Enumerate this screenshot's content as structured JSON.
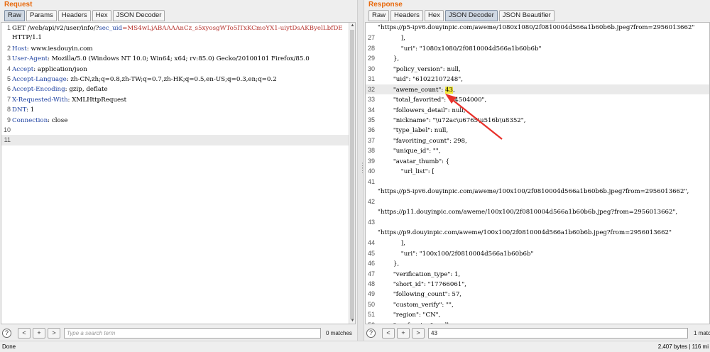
{
  "request": {
    "title": "Request",
    "tabs": [
      "Raw",
      "Params",
      "Headers",
      "Hex",
      "JSON Decoder"
    ],
    "active_tab": "Raw",
    "lines": [
      {
        "n": "1",
        "segments": [
          {
            "t": "GET /web/api/v2/user/info/?",
            "c": ""
          },
          {
            "t": "sec_uid",
            "c": "hname"
          },
          {
            "t": "=MS4wLjABAAAAnCz_s5xyosgWTo5lTxKCmoYX1-uiytDsAKByelLbfDE",
            "c": "hsec"
          }
        ]
      },
      {
        "n": "",
        "segments": [
          {
            "t": "HTTP/1.1",
            "c": ""
          }
        ]
      },
      {
        "n": "2",
        "segments": [
          {
            "t": "Host",
            "c": "hname"
          },
          {
            "t": ": www.iesdouyin.com",
            "c": ""
          }
        ]
      },
      {
        "n": "3",
        "segments": [
          {
            "t": "User-Agent",
            "c": "hname"
          },
          {
            "t": ": Mozilla/5.0 (Windows NT 10.0; Win64; x64; rv:85.0) Gecko/20100101 Firefox/85.0",
            "c": ""
          }
        ]
      },
      {
        "n": "4",
        "segments": [
          {
            "t": "Accept",
            "c": "hname"
          },
          {
            "t": ": application/json",
            "c": ""
          }
        ]
      },
      {
        "n": "5",
        "segments": [
          {
            "t": "Accept-Language",
            "c": "hname"
          },
          {
            "t": ": zh-CN,zh;q=0.8,zh-TW;q=0.7,zh-HK;q=0.5,en-US;q=0.3,en;q=0.2",
            "c": ""
          }
        ]
      },
      {
        "n": "6",
        "segments": [
          {
            "t": "Accept-Encoding",
            "c": "hname"
          },
          {
            "t": ": gzip, deflate",
            "c": ""
          }
        ]
      },
      {
        "n": "7",
        "segments": [
          {
            "t": "X-Requested-With",
            "c": "hname"
          },
          {
            "t": ": XMLHttpRequest",
            "c": ""
          }
        ]
      },
      {
        "n": "8",
        "segments": [
          {
            "t": "DNT",
            "c": "hname"
          },
          {
            "t": ": 1",
            "c": ""
          }
        ]
      },
      {
        "n": "9",
        "segments": [
          {
            "t": "Connection",
            "c": "hname"
          },
          {
            "t": ": close",
            "c": ""
          }
        ]
      },
      {
        "n": "10",
        "segments": []
      },
      {
        "n": "11",
        "segments": [],
        "highlight": true
      }
    ],
    "search": {
      "placeholder": "Type a search term",
      "value": "",
      "matches": "0 matches"
    }
  },
  "response": {
    "title": "Response",
    "tabs": [
      "Raw",
      "Headers",
      "Hex",
      "JSON Decoder",
      "JSON Beautifier"
    ],
    "active_tab": "JSON Decoder",
    "lines": [
      {
        "n": "",
        "t": "\"https://p5-ipv6.douyinpic.com/aweme/1080x1080/2f0810004d566a1b60b6b.jpeg?from=2956013662\""
      },
      {
        "n": "27",
        "t": "            ],"
      },
      {
        "n": "28",
        "t": "            \"uri\": \"1080x1080/2f0810004d566a1b60b6b\""
      },
      {
        "n": "29",
        "t": "        },"
      },
      {
        "n": "30",
        "t": "        \"policy_version\": null,"
      },
      {
        "n": "31",
        "t": "        \"uid\": \"61022107248\","
      },
      {
        "n": "32",
        "t": "        \"aweme_count\": ",
        "mark": "43",
        "after": ",",
        "highlight": true
      },
      {
        "n": "33",
        "t": "        \"total_favorited\": \"44504000\","
      },
      {
        "n": "34",
        "t": "        \"followers_detail\": null,"
      },
      {
        "n": "35",
        "t": "        \"nickname\": \"\\u72ac\\u6765\\u516b\\u8352\","
      },
      {
        "n": "36",
        "t": "        \"type_label\": null,"
      },
      {
        "n": "37",
        "t": "        \"favoriting_count\": 298,"
      },
      {
        "n": "38",
        "t": "        \"unique_id\": \"\","
      },
      {
        "n": "39",
        "t": "        \"avatar_thumb\": {"
      },
      {
        "n": "40",
        "t": "            \"url_list\": ["
      },
      {
        "n": "41",
        "t": ""
      },
      {
        "n": "",
        "t": "\"https://p5-ipv6.douyinpic.com/aweme/100x100/2f0810004d566a1b60b6b.jpeg?from=2956013662\","
      },
      {
        "n": "42",
        "t": ""
      },
      {
        "n": "",
        "t": "\"https://p11.douyinpic.com/aweme/100x100/2f0810004d566a1b60b6b.jpeg?from=2956013662\","
      },
      {
        "n": "43",
        "t": ""
      },
      {
        "n": "",
        "t": "\"https://p9.douyinpic.com/aweme/100x100/2f0810004d566a1b60b6b.jpeg?from=2956013662\""
      },
      {
        "n": "44",
        "t": "            ],"
      },
      {
        "n": "45",
        "t": "            \"uri\": \"100x100/2f0810004d566a1b60b6b\""
      },
      {
        "n": "46",
        "t": "        },"
      },
      {
        "n": "47",
        "t": "        \"verification_type\": 1,"
      },
      {
        "n": "48",
        "t": "        \"short_id\": \"17766061\","
      },
      {
        "n": "49",
        "t": "        \"following_count\": 57,"
      },
      {
        "n": "50",
        "t": "        \"custom_verify\": \"\","
      },
      {
        "n": "51",
        "t": "        \"region\": \"CN\","
      },
      {
        "n": "52",
        "t": "        \"geofencing\": null"
      }
    ],
    "search": {
      "placeholder": "",
      "value": "43",
      "matches": "1 matc"
    }
  },
  "buttons": {
    "help": "?",
    "prev": "<",
    "add": "+",
    "next": ">"
  },
  "status": {
    "left": "Done",
    "right": "2,407 bytes | 116 mi"
  },
  "colors": {
    "title": "#e8690c",
    "header_name": "#1b3fa0",
    "param_value": "#b5302b",
    "highlight": "#f5ea3a",
    "arrow": "#e8302a"
  }
}
